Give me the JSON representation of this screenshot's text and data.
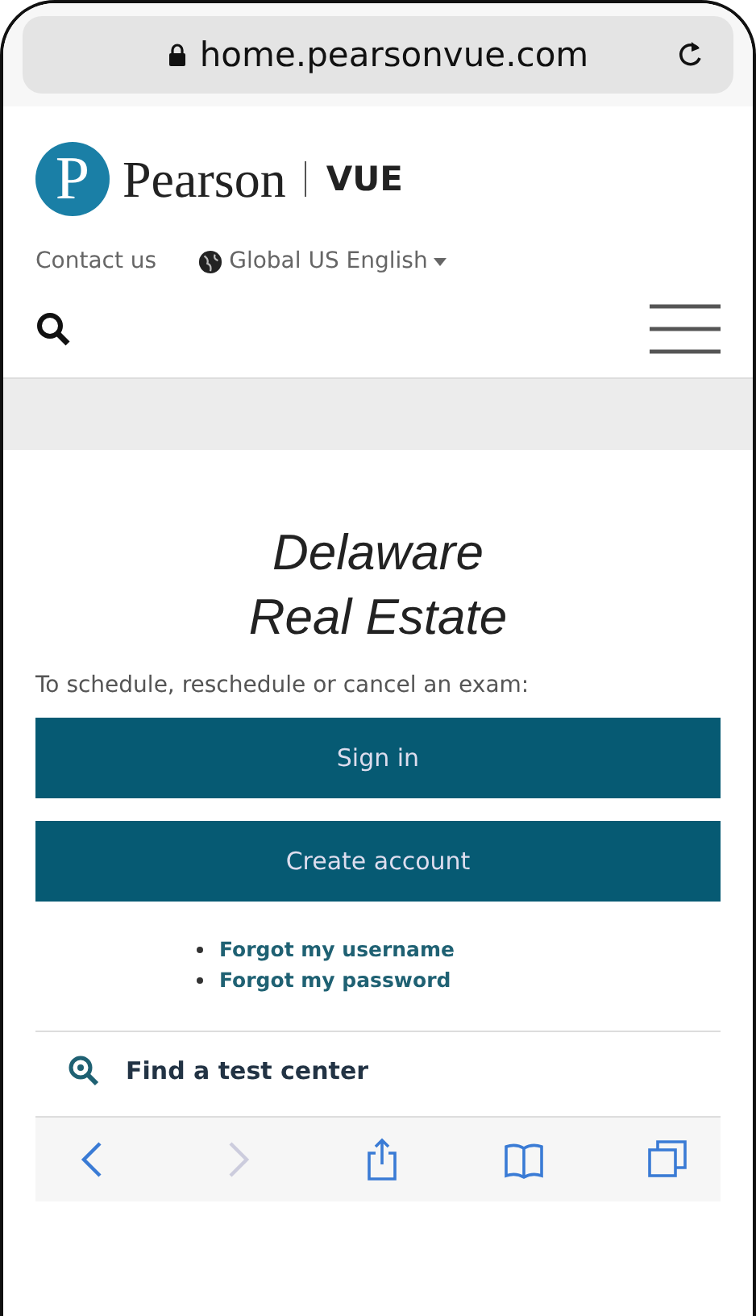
{
  "browser": {
    "address": "home.pearsonvue.com"
  },
  "header": {
    "logo_mark": "P",
    "brand": "Pearson",
    "product": "VUE",
    "contact": "Contact us",
    "language": "Global US English"
  },
  "content": {
    "title_lines": [
      "Delaware",
      "Real Estate"
    ],
    "intro": "To schedule, reschedule or cancel an exam:",
    "buttons": [
      "Sign in",
      "Create account"
    ],
    "links": [
      "Forgot my username",
      "Forgot my password"
    ],
    "find": "Find a test center"
  },
  "toolbar": [
    {
      "kind": "back",
      "disabled": false
    },
    {
      "kind": "forward",
      "disabled": true
    },
    {
      "kind": "share",
      "disabled": false
    },
    {
      "kind": "bookmarks",
      "disabled": false
    },
    {
      "kind": "tabs",
      "disabled": false
    }
  ]
}
